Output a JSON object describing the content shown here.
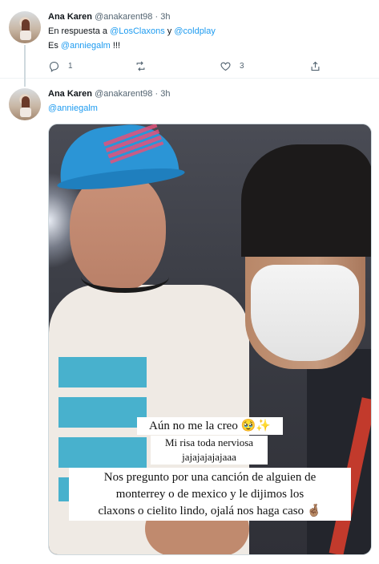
{
  "tweet1": {
    "name": "Ana Karen",
    "handle_time": "@anakarent98 · 3h",
    "reply_prefix": "En respuesta a ",
    "reply_mention1": "@LosClaxons",
    "reply_and": " y ",
    "reply_mention2": "@coldplay",
    "body_prefix": "Es ",
    "body_mention": "@anniegalm",
    "body_suffix": " !!!",
    "reply_count": "1",
    "retweet_count": "",
    "like_count": "3"
  },
  "tweet2": {
    "name": "Ana Karen",
    "handle_time": "@anakarent98 · 3h",
    "body_mention": "@anniegalm",
    "captions": {
      "line1": "Aún no me la creo 🥹✨",
      "line2": "Mi risa toda nerviosa",
      "line3": "jajajajajajaaa",
      "line4a": "Nos pregunto por una canción de alguien de",
      "line4b": "monterrey o de mexico y le dijimos los",
      "line4c": "claxons o cielito lindo, ojalá nos haga caso 🤞🏽"
    }
  },
  "icons": {
    "reply": "reply-icon",
    "retweet": "retweet-icon",
    "like": "heart-icon",
    "share": "share-icon"
  },
  "colors": {
    "link": "#1d9bf0",
    "text": "#0f1419",
    "secondary": "#536471"
  }
}
